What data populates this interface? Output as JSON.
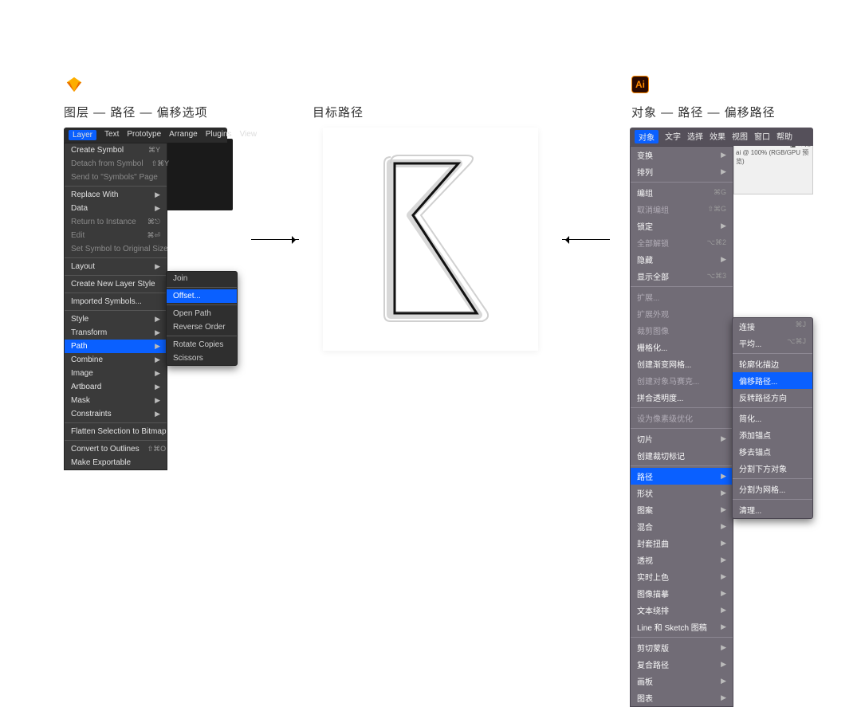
{
  "headings": {
    "left": "图层 — 路径 — 偏移选项",
    "center": "目标路径",
    "right": "对象 — 路径 — 偏移路径"
  },
  "sketch": {
    "menubar": [
      "Layer",
      "Text",
      "Prototype",
      "Arrange",
      "Plugins",
      "View"
    ],
    "menu": [
      {
        "label": "Create Symbol",
        "shortcut": "⌘Y"
      },
      {
        "label": "Detach from Symbol",
        "shortcut": "⇧⌘Y",
        "dim": true
      },
      {
        "label": "Send to \"Symbols\" Page",
        "dim": true
      },
      {
        "sep": true
      },
      {
        "label": "Replace With",
        "arrow": true
      },
      {
        "label": "Data",
        "arrow": true
      },
      {
        "label": "Return to Instance",
        "shortcut": "⌘⎋",
        "dim": true
      },
      {
        "label": "Edit",
        "shortcut": "⌘⏎",
        "dim": true
      },
      {
        "label": "Set Symbol to Original Size",
        "dim": true
      },
      {
        "sep": true
      },
      {
        "label": "Layout",
        "arrow": true
      },
      {
        "sep": true
      },
      {
        "label": "Create New Layer Style"
      },
      {
        "sep": true
      },
      {
        "label": "Imported Symbols..."
      },
      {
        "sep": true
      },
      {
        "label": "Style",
        "arrow": true
      },
      {
        "label": "Transform",
        "arrow": true
      },
      {
        "label": "Path",
        "arrow": true,
        "hl": true
      },
      {
        "label": "Combine",
        "arrow": true
      },
      {
        "label": "Image",
        "arrow": true
      },
      {
        "label": "Artboard",
        "arrow": true
      },
      {
        "label": "Mask",
        "arrow": true
      },
      {
        "label": "Constraints",
        "arrow": true
      },
      {
        "sep": true
      },
      {
        "label": "Flatten Selection to Bitmap"
      },
      {
        "sep": true
      },
      {
        "label": "Convert to Outlines",
        "shortcut": "⇧⌘O"
      },
      {
        "label": "Make Exportable"
      }
    ],
    "submenu": [
      {
        "label": "Join",
        "dim": true
      },
      {
        "sep": true
      },
      {
        "label": "Offset...",
        "hl": true
      },
      {
        "sep": true
      },
      {
        "label": "Open Path"
      },
      {
        "label": "Reverse Order"
      },
      {
        "sep": true
      },
      {
        "label": "Rotate Copies"
      },
      {
        "label": "Scissors"
      }
    ]
  },
  "illustrator": {
    "menubar": [
      "对象",
      "文字",
      "选择",
      "效果",
      "视图",
      "窗口",
      "帮助"
    ],
    "menu": [
      {
        "label": "变换",
        "arrow": true
      },
      {
        "label": "排列",
        "arrow": true
      },
      {
        "sep": true
      },
      {
        "label": "编组",
        "shortcut": "⌘G"
      },
      {
        "label": "取消编组",
        "shortcut": "⇧⌘G",
        "dim": true
      },
      {
        "label": "锁定",
        "arrow": true
      },
      {
        "label": "全部解锁",
        "shortcut": "⌥⌘2",
        "dim": true
      },
      {
        "label": "隐藏",
        "arrow": true
      },
      {
        "label": "显示全部",
        "shortcut": "⌥⌘3"
      },
      {
        "sep": true
      },
      {
        "label": "扩展...",
        "dim": true
      },
      {
        "label": "扩展外观",
        "dim": true
      },
      {
        "label": "裁剪图像",
        "dim": true
      },
      {
        "label": "栅格化..."
      },
      {
        "label": "创建渐变网格..."
      },
      {
        "label": "创建对象马赛克...",
        "dim": true
      },
      {
        "label": "拼合透明度..."
      },
      {
        "sep": true
      },
      {
        "label": "设为像素级优化",
        "dim": true
      },
      {
        "sep": true
      },
      {
        "label": "切片",
        "arrow": true
      },
      {
        "label": "创建裁切标记"
      },
      {
        "sep": true
      },
      {
        "label": "路径",
        "arrow": true,
        "hl": true
      },
      {
        "label": "形状",
        "arrow": true
      },
      {
        "label": "图案",
        "arrow": true
      },
      {
        "label": "混合",
        "arrow": true
      },
      {
        "label": "封套扭曲",
        "arrow": true
      },
      {
        "label": "透视",
        "arrow": true
      },
      {
        "label": "实时上色",
        "arrow": true
      },
      {
        "label": "图像描摹",
        "arrow": true
      },
      {
        "label": "文本绕排",
        "arrow": true
      },
      {
        "label": "Line 和 Sketch 图稿",
        "arrow": true
      },
      {
        "sep": true
      },
      {
        "label": "剪切蒙版",
        "arrow": true
      },
      {
        "label": "复合路径",
        "arrow": true
      },
      {
        "label": "画板",
        "arrow": true
      },
      {
        "label": "图表",
        "arrow": true
      }
    ],
    "submenu": [
      {
        "label": "连接",
        "shortcut": "⌘J"
      },
      {
        "label": "平均...",
        "shortcut": "⌥⌘J"
      },
      {
        "sep": true
      },
      {
        "label": "轮廓化描边"
      },
      {
        "label": "偏移路径...",
        "hl": true
      },
      {
        "label": "反转路径方向"
      },
      {
        "sep": true
      },
      {
        "label": "简化..."
      },
      {
        "label": "添加锚点"
      },
      {
        "label": "移去锚点"
      },
      {
        "label": "分割下方对象"
      },
      {
        "sep": true
      },
      {
        "label": "分割为网格..."
      },
      {
        "sep": true
      },
      {
        "label": "清理..."
      }
    ],
    "bg_note": "ai @ 100% (RGB/GPU 预览)"
  }
}
